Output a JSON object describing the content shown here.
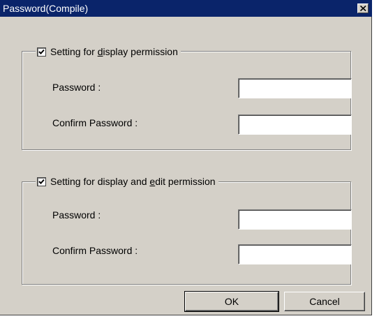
{
  "window": {
    "title": "Password(Compile)"
  },
  "group_display": {
    "label_prefix": "Setting for ",
    "label_mnemonic": "d",
    "label_suffix": "isplay permission",
    "checked": true,
    "password_label": "Password :",
    "confirm_label": "Confirm Password :",
    "password_value": "",
    "confirm_value": ""
  },
  "group_edit": {
    "label_prefix": "Setting for display and ",
    "label_mnemonic": "e",
    "label_suffix": "dit permission",
    "checked": true,
    "password_label": "Password :",
    "confirm_label": "Confirm Password :",
    "password_value": "",
    "confirm_value": ""
  },
  "buttons": {
    "ok": "OK",
    "cancel": "Cancel"
  }
}
